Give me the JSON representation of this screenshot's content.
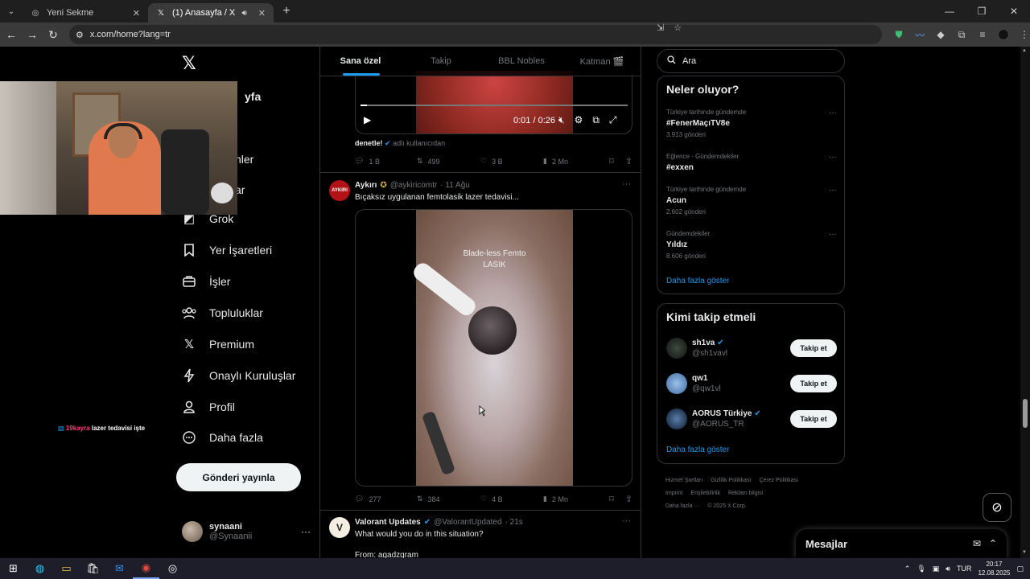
{
  "browser": {
    "tabs": [
      {
        "title": "Yeni Sekme"
      },
      {
        "title": "(1) Anasayfa / X"
      }
    ],
    "url": "x.com/home?lang=tr"
  },
  "nav": {
    "items": [
      {
        "label": "Grok",
        "icon": "grok-icon"
      },
      {
        "label": "Yer İşaretleri",
        "icon": "bookmark-icon"
      },
      {
        "label": "İşler",
        "icon": "briefcase-icon"
      },
      {
        "label": "Topluluklar",
        "icon": "communities-icon"
      },
      {
        "label": "Premium",
        "icon": "x-logo-icon"
      },
      {
        "label": "Onaylı Kuruluşlar",
        "icon": "lightning-icon"
      },
      {
        "label": "Profil",
        "icon": "profile-icon"
      },
      {
        "label": "Daha fazla",
        "icon": "more-circle-icon"
      }
    ],
    "partial": [
      "yfa",
      "nler",
      "ar"
    ],
    "post_button": "Gönderi yayınla",
    "account": {
      "name": "synaani",
      "handle": "@Synaanii"
    }
  },
  "overlay_caption": {
    "highlight": "19kayra",
    "rest": "lazer tedavisi işte"
  },
  "feed": {
    "tabs": [
      "Sana özel",
      "Takip",
      "BBL Nobles",
      "Katman 🎬"
    ],
    "video1": {
      "time": "0:01 / 0:26"
    },
    "source": {
      "user": "denetle!",
      "suffix": "adlı kullanıcıdan"
    },
    "tweet1_actions": {
      "replies": "1 B",
      "reposts": "499",
      "likes": "3 B",
      "views": "2 Mn"
    },
    "tweet2": {
      "name": "Aykırı",
      "handle": "@aykiricomtr",
      "time": "· 11 Ağu",
      "text": "Bıçaksız uygulanan femtolasik lazer tedavisi...",
      "avatar_text": "AYKIRI",
      "video_text_1": "Blade-less Femto",
      "video_text_2": "LASIK",
      "actions": {
        "replies": "277",
        "reposts": "384",
        "likes": "4 B",
        "views": "2 Mn"
      }
    },
    "tweet3": {
      "name": "Valorant Updates",
      "handle": "@ValorantUpdated",
      "time": "· 21s",
      "text": "What would you do in this situation?",
      "text2": "From: agadzgram"
    }
  },
  "right": {
    "search_placeholder": "Ara",
    "trends_title": "Neler oluyor?",
    "trends": [
      {
        "context": "Türkiye tarihinde gündemde",
        "topic": "#FenerMaçıTV8e",
        "count": "3.913 gönderi"
      },
      {
        "context": "Eğlence · Gündemdekiler",
        "topic": "#exxen",
        "count": ""
      },
      {
        "context": "Türkiye tarihinde gündemde",
        "topic": "Acun",
        "count": "2.602 gönderi"
      },
      {
        "context": "Gündemdekiler",
        "topic": "Yıldız",
        "count": "8.606 gönderi"
      }
    ],
    "show_more": "Daha fazla göster",
    "who_title": "Kimi takip etmeli",
    "who": [
      {
        "name": "sh1va",
        "handle": "@sh1vavl",
        "button": "Takip et"
      },
      {
        "name": "qw1",
        "handle": "@qw1vl",
        "button": "Takip et"
      },
      {
        "name": "AORUS Türkiye",
        "handle": "@AORUS_TR",
        "button": "Takip et"
      }
    ],
    "who_show_more": "Daha fazla göster",
    "footer": [
      "Hizmet Şartları",
      "Gizlilik Politikası",
      "Çerez Politikası",
      "Imprint",
      "Erişilebilirlik",
      "Reklam bilgisi",
      "Daha fazla ···",
      "© 2025 X Corp."
    ]
  },
  "messages": {
    "title": "Mesajlar"
  },
  "taskbar": {
    "lang": "TUR",
    "time": "20:17",
    "date": "12.08.2025"
  }
}
